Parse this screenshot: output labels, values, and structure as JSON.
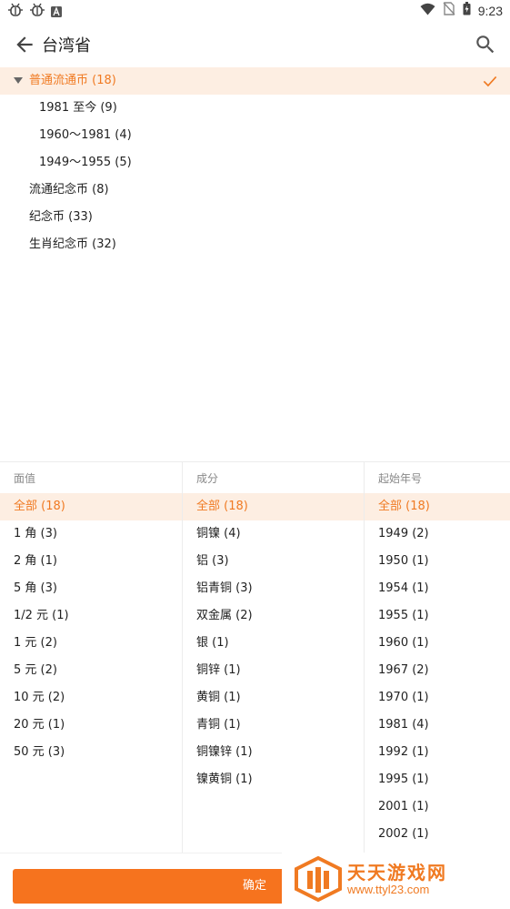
{
  "status_bar": {
    "left_icons": [
      "bug-icon",
      "bug-icon",
      "a-badge-icon"
    ],
    "right_icons": [
      "wifi-icon",
      "no-sim-icon",
      "battery-icon"
    ],
    "time": "9:23"
  },
  "app_bar": {
    "title": "台湾省",
    "back_icon": "arrow-left-icon",
    "search_icon": "search-icon"
  },
  "tree": {
    "selected": {
      "label": "普通流通币 (18)",
      "expanded": true,
      "checked": true
    },
    "children": [
      {
        "label": "1981 至今 (9)"
      },
      {
        "label": "1960～1981 (4)"
      },
      {
        "label": "1949～1955 (5)"
      }
    ],
    "siblings": [
      {
        "label": "流通纪念币 (8)"
      },
      {
        "label": "纪念币 (33)"
      },
      {
        "label": "生肖纪念币 (32)"
      }
    ]
  },
  "filters": {
    "denomination": {
      "header": "面值",
      "options": [
        "全部 (18)",
        "1 角 (3)",
        "2 角 (1)",
        "5 角 (3)",
        "1/2 元 (1)",
        "1 元 (2)",
        "5 元 (2)",
        "10 元 (2)",
        "20 元 (1)",
        "50 元 (3)"
      ],
      "selected_index": 0
    },
    "composition": {
      "header": "成分",
      "options": [
        "全部 (18)",
        "铜镍 (4)",
        "铝 (3)",
        "铝青铜 (3)",
        "双金属 (2)",
        "银 (1)",
        "铜锌 (1)",
        "黄铜 (1)",
        "青铜 (1)",
        "铜镍锌 (1)",
        "镍黄铜 (1)"
      ],
      "selected_index": 0
    },
    "start_year": {
      "header": "起始年号",
      "options": [
        "全部 (18)",
        "1949 (2)",
        "1950 (1)",
        "1954 (1)",
        "1955 (1)",
        "1960 (1)",
        "1967 (2)",
        "1970 (1)",
        "1981 (4)",
        "1992 (1)",
        "1995 (1)",
        "2001 (1)",
        "2002 (1)"
      ],
      "selected_index": 0
    }
  },
  "confirm_label": "确定",
  "watermark": {
    "line1": "天天游戏网",
    "line2": "www.ttyl23.com"
  },
  "colors": {
    "accent": "#f6731e",
    "selected_bg": "#fdeee2",
    "selected_text": "#f07a22"
  }
}
